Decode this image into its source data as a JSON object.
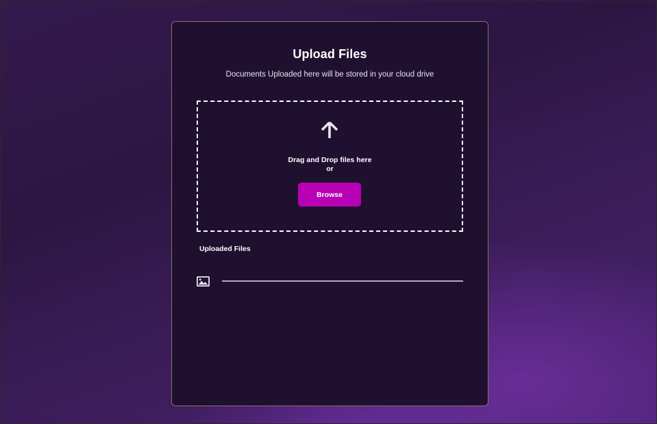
{
  "upload_card": {
    "title": "Upload Files",
    "subtitle": "Documents Uploaded here will be stored in your cloud drive",
    "dropzone": {
      "icon": "arrow-up-icon",
      "instruction": "Drag and Drop files here",
      "separator": "or",
      "browse_label": "Browse"
    },
    "uploaded_files": {
      "heading": "Uploaded Files",
      "items": [
        {
          "icon": "image-file-icon",
          "progress": 1.0
        }
      ]
    }
  },
  "colors": {
    "card_background": "#1f1030",
    "card_border": "#8d7069",
    "accent_button": "#b800b5",
    "progress_bar": "#c7a3cf",
    "page_background": "#341a4d"
  }
}
